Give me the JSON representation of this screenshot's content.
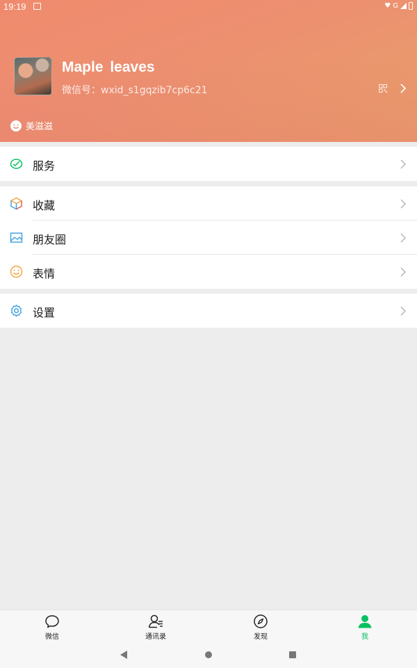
{
  "status_bar": {
    "time": "19:19",
    "network": "G"
  },
  "profile": {
    "name": "Maple  leaves",
    "wechat_id_label": "微信号：",
    "wechat_id": "wxid_s1gqzib7cp6c21",
    "status_text": "美滋滋"
  },
  "menu": {
    "services": {
      "label": "服务"
    },
    "favorites": {
      "label": "收藏"
    },
    "moments": {
      "label": "朋友圈"
    },
    "stickers": {
      "label": "表情"
    },
    "settings": {
      "label": "设置"
    }
  },
  "tabs": [
    {
      "label": "微信",
      "icon": "chat-bubble-icon"
    },
    {
      "label": "通讯录",
      "icon": "contacts-icon"
    },
    {
      "label": "发现",
      "icon": "compass-icon"
    },
    {
      "label": "我",
      "icon": "me-icon"
    }
  ],
  "colors": {
    "accent": "#07c160",
    "header_start": "#f08a6e",
    "header_end": "#e8a06a"
  }
}
